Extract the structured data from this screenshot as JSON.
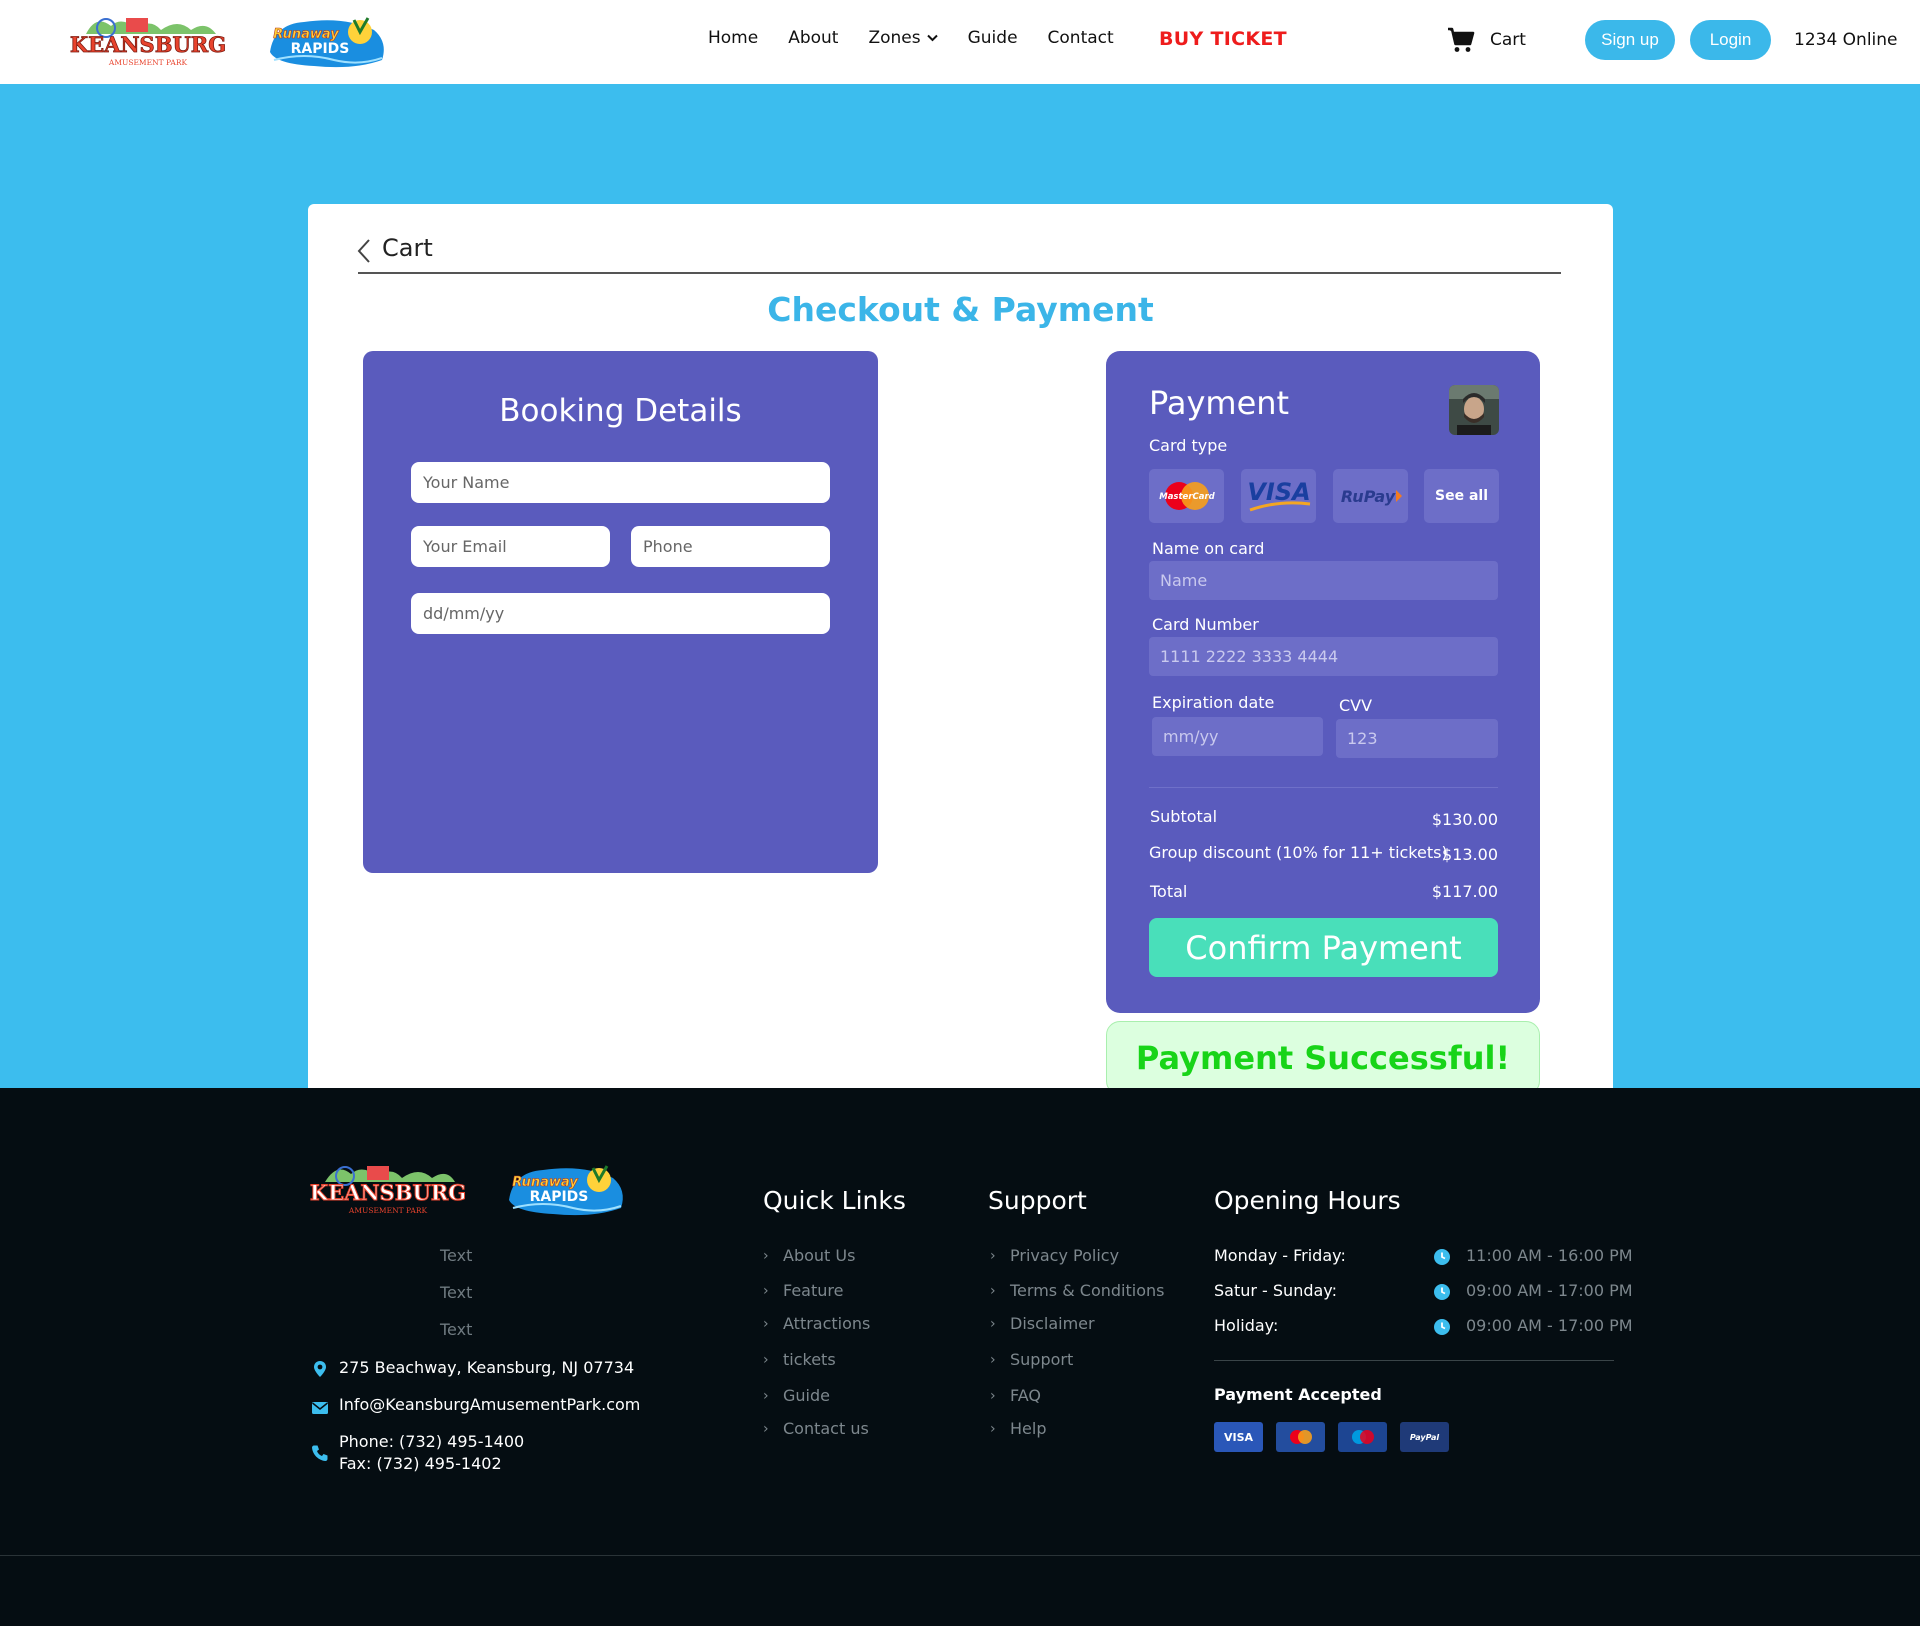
{
  "header": {
    "logo_keansburg": {
      "name": "KEANSBURG",
      "sub": "AMUSEMENT PARK"
    },
    "logo_runaway": {
      "line1": "Runaway",
      "line2": "RAPIDS"
    },
    "nav": [
      {
        "label": "Home"
      },
      {
        "label": "About"
      },
      {
        "label": "Zones"
      },
      {
        "label": "Guide"
      },
      {
        "label": "Contact"
      }
    ],
    "buy_ticket": "BUY TICKET",
    "cart": "Cart",
    "signup": "Sign up",
    "login": "Login",
    "online": "1234 Online"
  },
  "main": {
    "back_label": "Cart",
    "title": "Checkout & Payment",
    "booking": {
      "title": "Booking Details",
      "name_placeholder": "Your Name",
      "email_placeholder": "Your Email",
      "phone_placeholder": "Phone",
      "date_placeholder": "dd/mm/yy"
    },
    "payment": {
      "title": "Payment",
      "card_type_label": "Card type",
      "card_types": [
        "MasterCard",
        "VISA",
        "RuPay",
        "See all"
      ],
      "name_label": "Name on card",
      "name_placeholder": "Name",
      "number_label": "Card Number",
      "number_placeholder": "1111 2222 3333 4444",
      "expiry_label": "Expiration date",
      "expiry_placeholder": "mm/yy",
      "cvv_label": "CVV",
      "cvv_placeholder": "123",
      "subtotal_label": "Subtotal",
      "subtotal_value": "$130.00",
      "discount_label": "Group discount (10% for 11+ tickets)",
      "discount_value": "$13.00",
      "total_label": "Total",
      "total_value": "$117.00",
      "confirm_label": "Confirm Payment"
    },
    "success_message": "Payment Successful!"
  },
  "footer": {
    "texts": [
      "Text",
      "Text",
      "Text"
    ],
    "address": "275 Beachway, Keansburg, NJ 07734",
    "email": "Info@KeansburgAmusementPark.com",
    "phone": "Phone: (732) 495-1400",
    "fax": "Fax: (732) 495-1402",
    "quick_links_title": "Quick Links",
    "quick_links": [
      "About Us",
      "Feature",
      "Attractions",
      "tickets",
      "Guide",
      "Contact us"
    ],
    "support_title": "Support",
    "support_links": [
      "Privacy Policy",
      "Terms & Conditions",
      "Disclaimer",
      "Support",
      "FAQ",
      "Help"
    ],
    "hours_title": "Opening Hours",
    "hours": [
      {
        "day": "Monday - Friday:",
        "time": "11:00 AM - 16:00 PM"
      },
      {
        "day": "Satur - Sunday:",
        "time": "09:00 AM - 17:00 PM"
      },
      {
        "day": "Holiday:",
        "time": "09:00 AM - 17:00 PM"
      }
    ],
    "payment_accepted": "Payment Accepted",
    "payment_methods": [
      "VISA",
      "MasterCard",
      "Maestro",
      "PayPal"
    ]
  },
  "colors": {
    "accent_blue": "#3cbdee",
    "panel_purple": "#5a5bbd",
    "confirm_green": "#49dfba",
    "buy_red": "#ee1c1c",
    "success_green": "#18d418",
    "footer_bg": "#050d12"
  }
}
